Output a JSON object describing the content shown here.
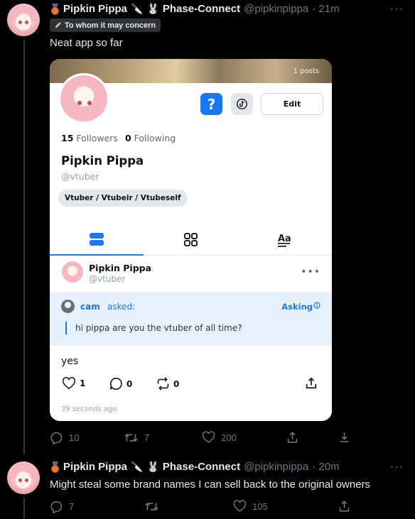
{
  "tweet1": {
    "name": "Pipkin Pippa",
    "badges": [
      "medal",
      "🔪",
      "🐰"
    ],
    "affiliation": "Phase-Connect",
    "handle": "@pipkinpippa",
    "time": "· 21m",
    "concern_label": "To whom it may concern",
    "text": "Neat app so far",
    "replies": "10",
    "retweets": "7",
    "likes": "200"
  },
  "card": {
    "posts": "1 posts",
    "edit_label": "Edit",
    "question_mark": "?",
    "followers_count": "15",
    "followers_label": "Followers",
    "following_count": "0",
    "following_label": "Following",
    "name": "Pipkin Pippa",
    "handle": "@vtuber",
    "bio_chip": "Vtuber / Vtubeir / Vtubeself",
    "post": {
      "name": "Pipkin Pippa",
      "handle": "@vtuber",
      "asker": "cam",
      "asked_label": "asked:",
      "asking_label": "Asking",
      "question": "hi pippa are you the vtuber of all time?",
      "answer": "yes",
      "likes": "1",
      "comments": "0",
      "reposts": "0",
      "ago": "39 seconds ago"
    }
  },
  "tweet2": {
    "name": "Pipkin Pippa",
    "affiliation": "Phase-Connect",
    "handle": "@pipkinpippa",
    "time": "· 20m",
    "text": "Might steal some brand names I can sell back to the original owners",
    "replies": "7",
    "retweets": "",
    "likes": "105"
  },
  "colors": {
    "background": "#000000",
    "text": "#e7e9ea",
    "muted": "#71767b",
    "accent": "#1877f2"
  }
}
